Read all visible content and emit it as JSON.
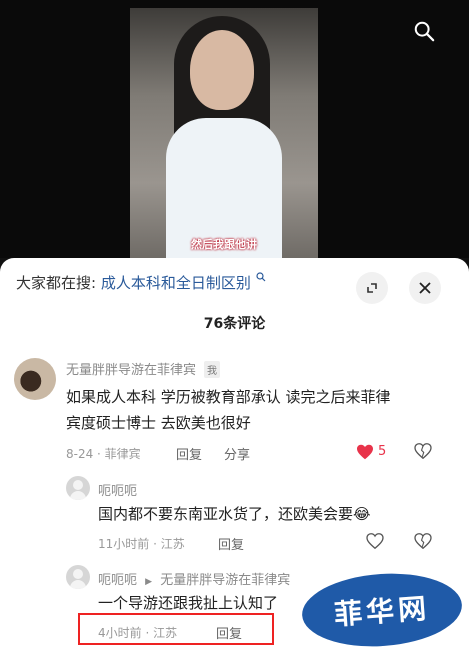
{
  "video": {
    "caption": "然后我跟他讲"
  },
  "header": {
    "search_prefix": "大家都在搜:",
    "search_link": "成人本科和全日制区别",
    "comment_count": "76条评论"
  },
  "comments": [
    {
      "user": "无量胖胖导游在菲律宾",
      "tag": "我",
      "text_line1": "如果成人本科 学历被教育部承认 读完之后来菲律",
      "text_line2": "宾度硕士博士 去欧美也很好",
      "date": "8-24 · 菲律宾",
      "reply": "回复",
      "share": "分享",
      "likes": "5"
    },
    {
      "user": "呃呃呃",
      "text": "国内都不要东南亚水货了，还欧美会要",
      "emoji": "😂",
      "date": "11小时前 · 江苏",
      "reply": "回复"
    },
    {
      "user": "呃呃呃",
      "reply_to": "无量胖胖导游在菲律宾",
      "text": "一个导游还跟我扯上认知了",
      "date": "4小时前 · 江苏",
      "reply": "回复"
    }
  ],
  "watermark": "菲华网",
  "colors": {
    "accent": "#e8334a",
    "link": "#2a5a9a",
    "highlight": "#e22222",
    "watermark": "#1f5aa8"
  }
}
